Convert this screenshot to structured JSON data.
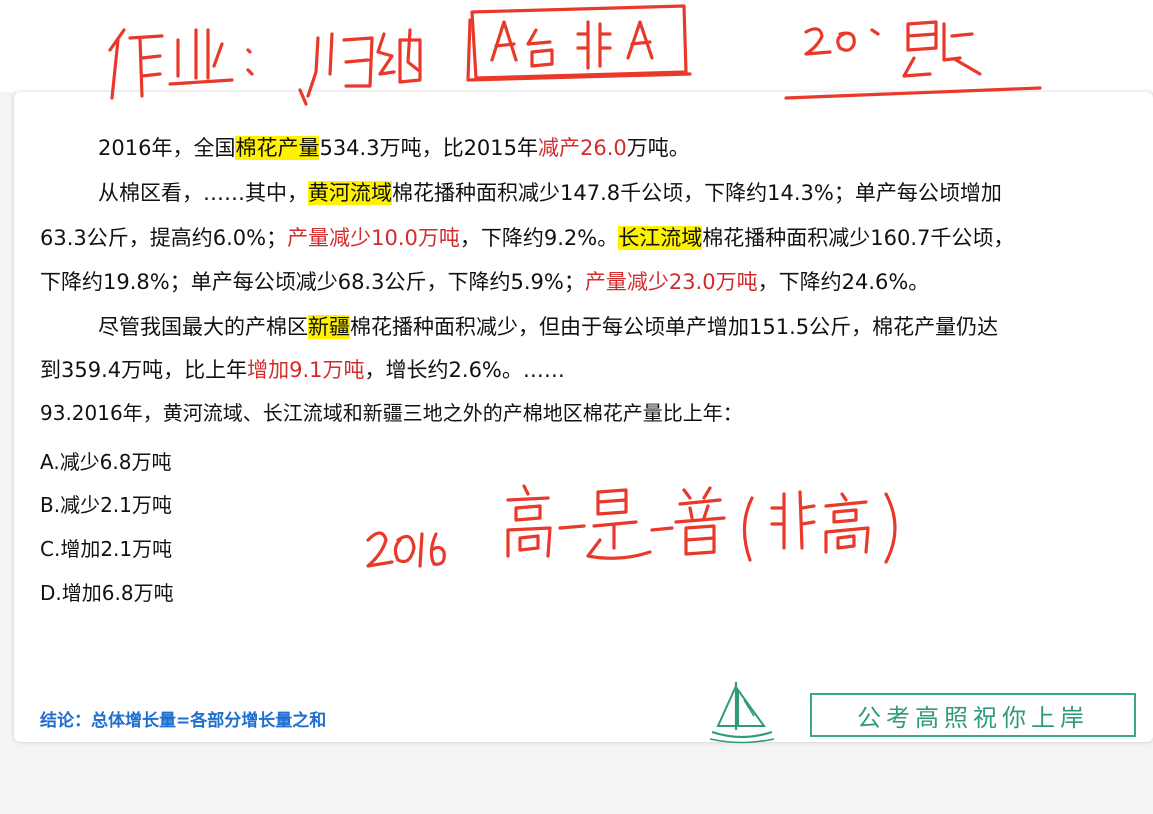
{
  "handwriting": {
    "top_note": "作业：归纳 A台非A 20题",
    "side_note": "2016 高-是-普（非高）"
  },
  "passage": {
    "p1": {
      "a": "2016年，全国",
      "hl1": "棉花产量",
      "b": "534.3万吨，比2015年",
      "red1": "减产26.0",
      "c": "万吨。"
    },
    "p2": {
      "a": "从棉区看，……其中，",
      "hl1": "黄河流域",
      "b": "棉花播种面积减少147.8千公顷，下降约14.3%；单产每公顷增加",
      "c": "63.3公斤，提高约6.0%；",
      "red1": "产量减少10.0万吨",
      "d": "，下降约9.2%。",
      "hl2": "长江流域",
      "e": "棉花播种面积减少160.7千公顷，",
      "f": "下降约19.8%；单产每公顷减少68.3公斤，下降约5.9%；",
      "red2": "产量减少23.0万吨",
      "g": "，下降约24.6%。"
    },
    "p3": {
      "a": "尽管我国最大的产棉区",
      "hl1": "新疆",
      "b": "棉花播种面积减少，但由于每公顷单产增加151.5公斤，棉花产量仍达",
      "c": "到359.4万吨，比上年",
      "red1": "增加9.1万吨",
      "d": "，增长约2.6%。……"
    }
  },
  "question": {
    "stem": "93.2016年，黄河流域、长江流域和新疆三地之外的产棉地区棉花产量比上年：",
    "options": [
      {
        "label": "A.减少6.8万吨"
      },
      {
        "label": "B.减少2.1万吨"
      },
      {
        "label": "C.增加2.1万吨"
      },
      {
        "label": "D.增加6.8万吨"
      }
    ]
  },
  "footer": {
    "conclusion": "结论：总体增长量=各部分增长量之和",
    "slogan": "公考高照祝你上岸"
  },
  "colors": {
    "highlight": "#fff200",
    "red_text": "#d32b2b",
    "ink": "#e8392a",
    "conclusion_blue": "#1f6fd0",
    "slogan_green": "#2f9a7c"
  },
  "icons": [
    "sailboat-icon"
  ]
}
